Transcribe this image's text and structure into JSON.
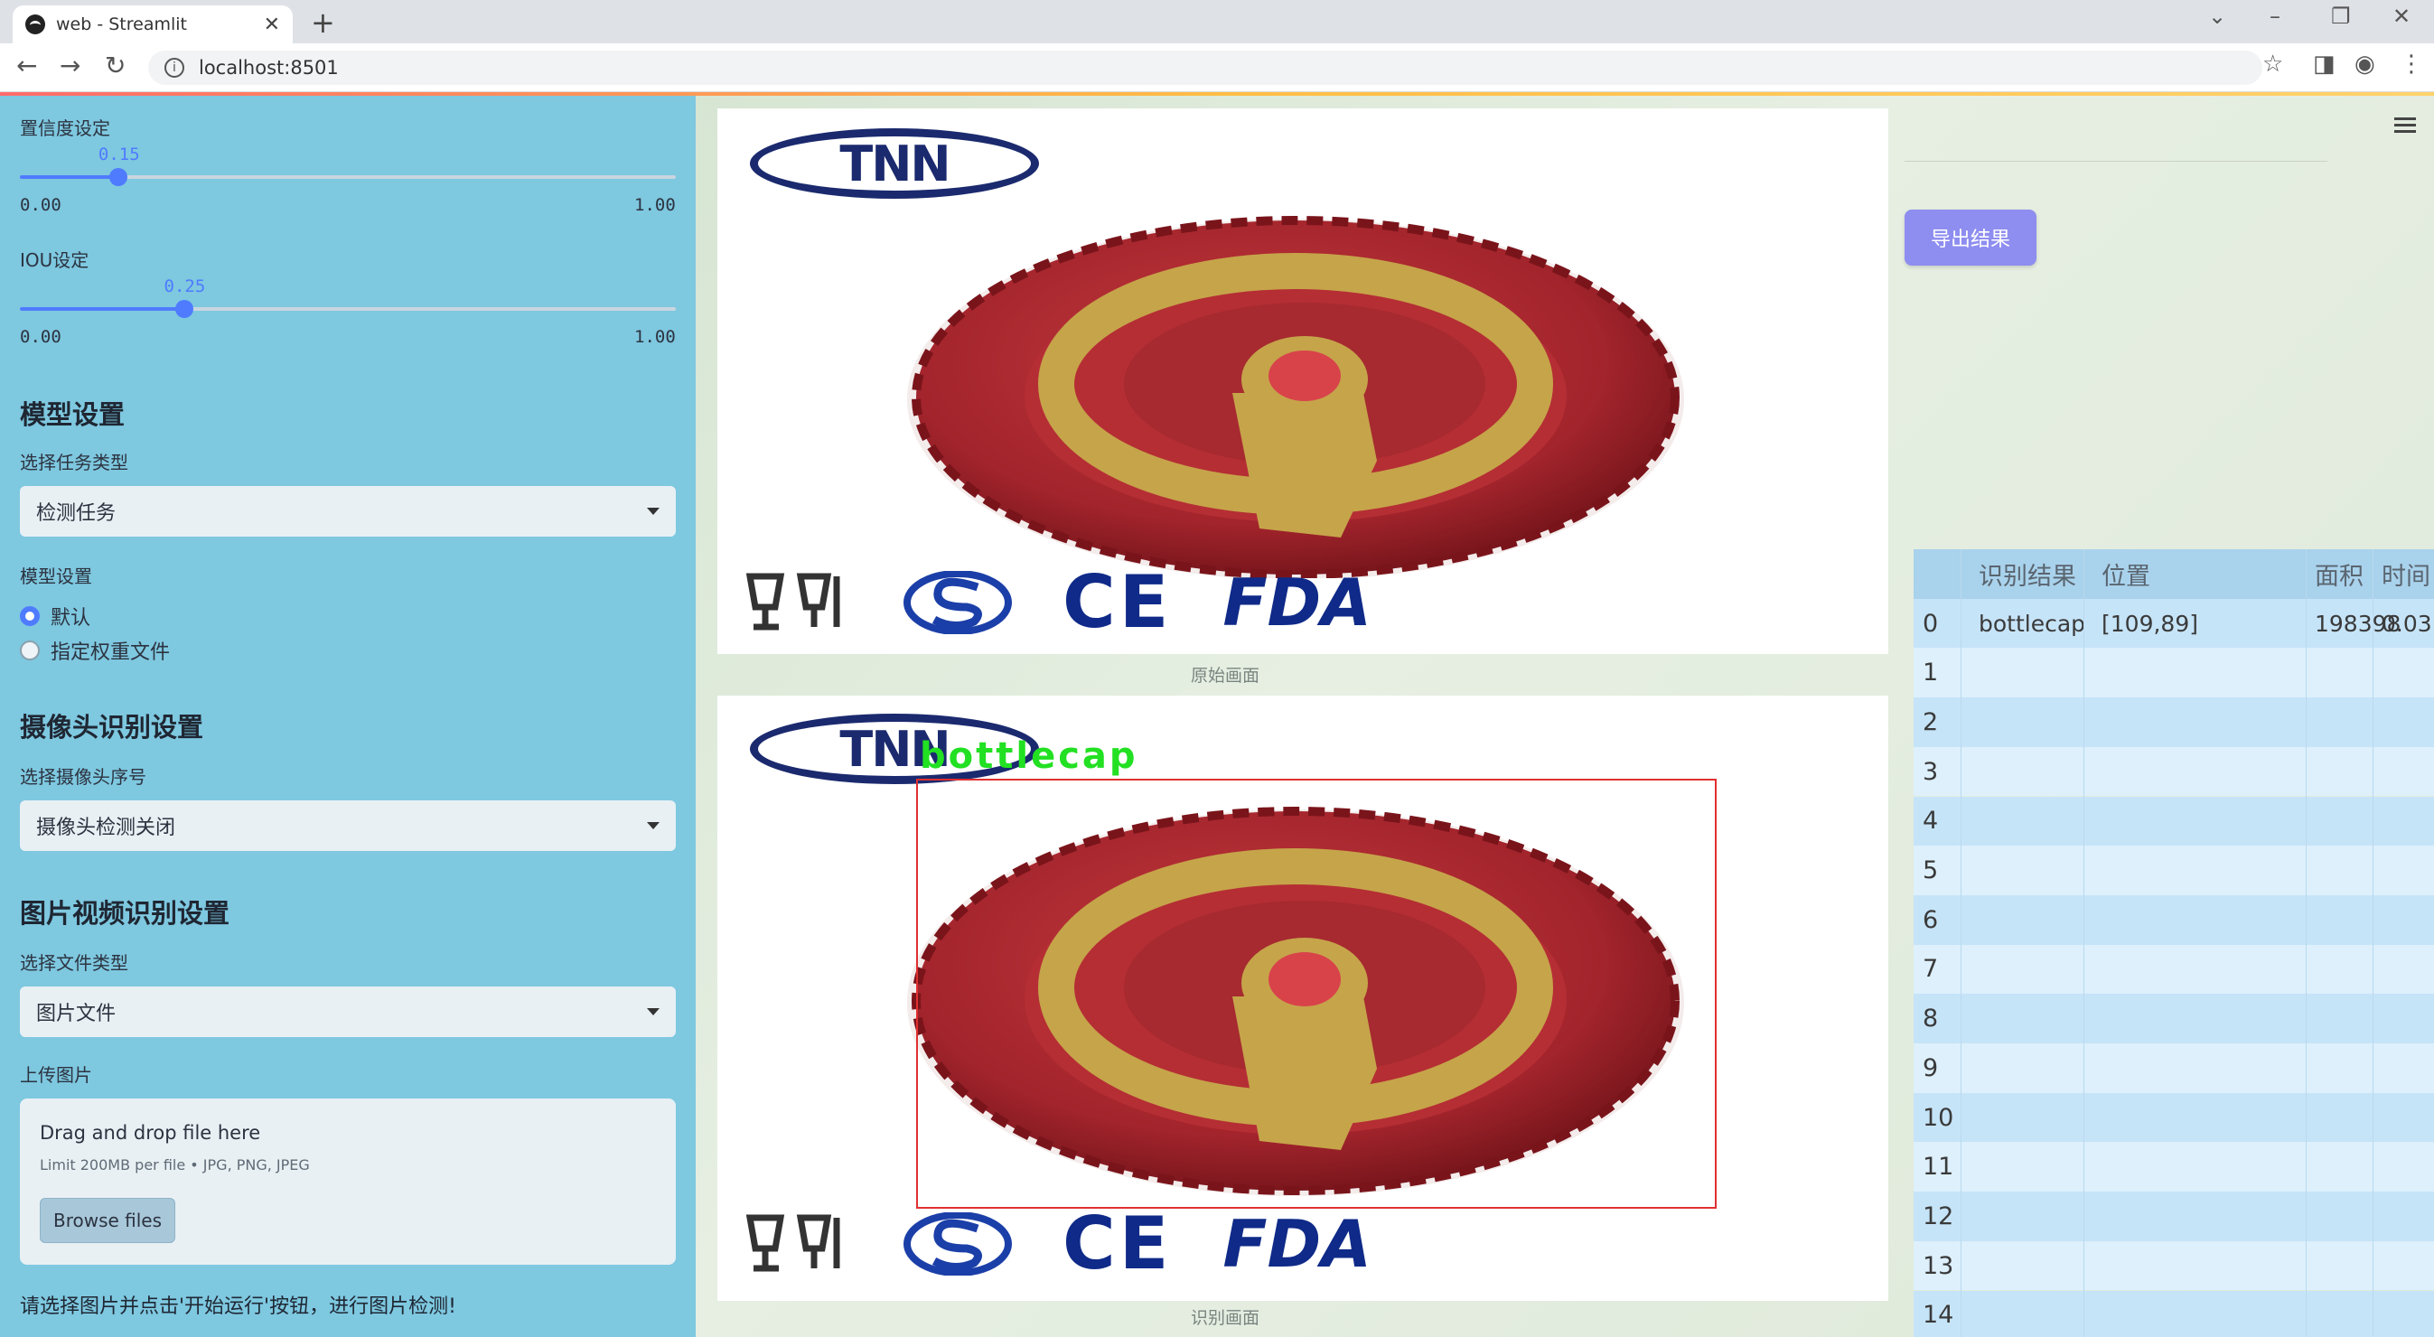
{
  "browser": {
    "tab_title": "web - Streamlit",
    "url": "localhost:8501"
  },
  "sidebar": {
    "confidence": {
      "label": "置信度设定",
      "value": "0.15",
      "min": "0.00",
      "max": "1.00",
      "fraction": 0.15
    },
    "iou": {
      "label": "IOU设定",
      "value": "0.25",
      "min": "0.00",
      "max": "1.00",
      "fraction": 0.25
    },
    "model_section": "模型设置",
    "task_label": "选择任务类型",
    "task_value": "检测任务",
    "model_label": "模型设置",
    "model_options": [
      "默认",
      "指定权重文件"
    ],
    "camera_section": "摄像头识别设置",
    "camera_label": "选择摄像头序号",
    "camera_value": "摄像头检测关闭",
    "media_section": "图片视频识别设置",
    "filetype_label": "选择文件类型",
    "filetype_value": "图片文件",
    "upload_label": "上传图片",
    "upload_title": "Drag and drop file here",
    "upload_limit": "Limit 200MB per file • JPG, PNG, JPEG",
    "browse_label": "Browse files",
    "hint": "请选择图片并点击'开始运行'按钮，进行图片检测!"
  },
  "main": {
    "logo_text": "TNN",
    "cert_ce": "CE",
    "cert_fda": "FDA",
    "original_caption": "原始画面",
    "result_caption": "识别画面",
    "detection_label": "bottlecap",
    "export_label": "导出结果"
  },
  "table": {
    "headers": [
      "识别结果",
      "位置",
      "面积",
      "时间"
    ],
    "rows": [
      {
        "idx": "0",
        "result": "bottlecap",
        "pos": "[109,89]",
        "area": "198398",
        "time": "0.03"
      },
      {
        "idx": "1"
      },
      {
        "idx": "2"
      },
      {
        "idx": "3"
      },
      {
        "idx": "4"
      },
      {
        "idx": "5"
      },
      {
        "idx": "6"
      },
      {
        "idx": "7"
      },
      {
        "idx": "8"
      },
      {
        "idx": "9"
      },
      {
        "idx": "10"
      },
      {
        "idx": "11"
      },
      {
        "idx": "12"
      },
      {
        "idx": "13"
      },
      {
        "idx": "14"
      }
    ]
  },
  "colors": {
    "accent": "#4f7bff",
    "sidebar_bg": "#7ec8e0",
    "export_btn": "#8e8df0",
    "det_box": "#e03030",
    "det_label": "#22e022"
  },
  "icons": [
    "back-icon",
    "forward-icon",
    "reload-icon",
    "info-icon",
    "star-icon",
    "sidepanel-icon",
    "profile-icon",
    "menu-icon",
    "caret-down-icon",
    "bottlecap-image",
    "cup-fork-icon",
    "s-mark-icon"
  ]
}
